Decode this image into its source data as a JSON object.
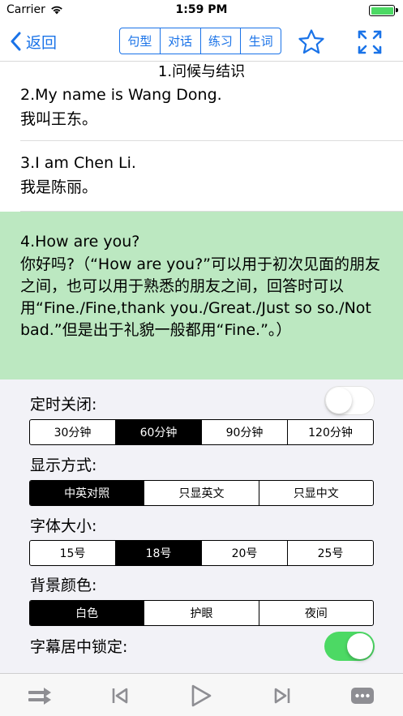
{
  "status_bar": {
    "carrier": "Carrier",
    "time": "1:59 PM",
    "battery_level": 1.0
  },
  "nav": {
    "back_label": "返回",
    "tabs": [
      {
        "label": "句型",
        "active": true
      },
      {
        "label": "对话",
        "active": false
      },
      {
        "label": "练习",
        "active": false
      },
      {
        "label": "生词",
        "active": false
      }
    ],
    "icons": {
      "star": "star-icon",
      "expand": "expand-icon"
    },
    "accent_color": "#1a73e8"
  },
  "lesson_title": "1.问候与结识",
  "sentences": [
    {
      "en": "2.My name is Wang Dong.",
      "zh": "我叫王东。"
    },
    {
      "en": "3.I am Chen Li.",
      "zh": "我是陈丽。"
    },
    {
      "en": "4.How are you?",
      "zh": "你好吗?（“How are you?”可以用于初次见面的朋友之间，也可以用于熟悉的朋友之间，回答时可以用“Fine./Fine,thank you./Great./Just so so./Not bad.”但是出于礼貌一般都用“Fine.”。）",
      "highlighted": true,
      "highlight_color": "#bce8c1"
    }
  ],
  "settings": {
    "timer": {
      "label": "定时关闭:",
      "enabled": false,
      "options": [
        "30分钟",
        "60分钟",
        "90分钟",
        "120分钟"
      ],
      "selected": 1
    },
    "display": {
      "label": "显示方式:",
      "options": [
        "中英对照",
        "只显英文",
        "只显中文"
      ],
      "selected": 0
    },
    "font_size": {
      "label": "字体大小:",
      "options": [
        "15号",
        "18号",
        "20号",
        "25号"
      ],
      "selected": 1
    },
    "background": {
      "label": "背景颜色:",
      "options": [
        "白色",
        "护眼",
        "夜间"
      ],
      "selected": 0
    },
    "subtitle_lock": {
      "label": "字幕居中锁定:",
      "enabled": true
    }
  },
  "tab_bar": {
    "icons": [
      "shuffle-icon",
      "previous-icon",
      "play-icon",
      "next-icon",
      "more-icon"
    ]
  }
}
